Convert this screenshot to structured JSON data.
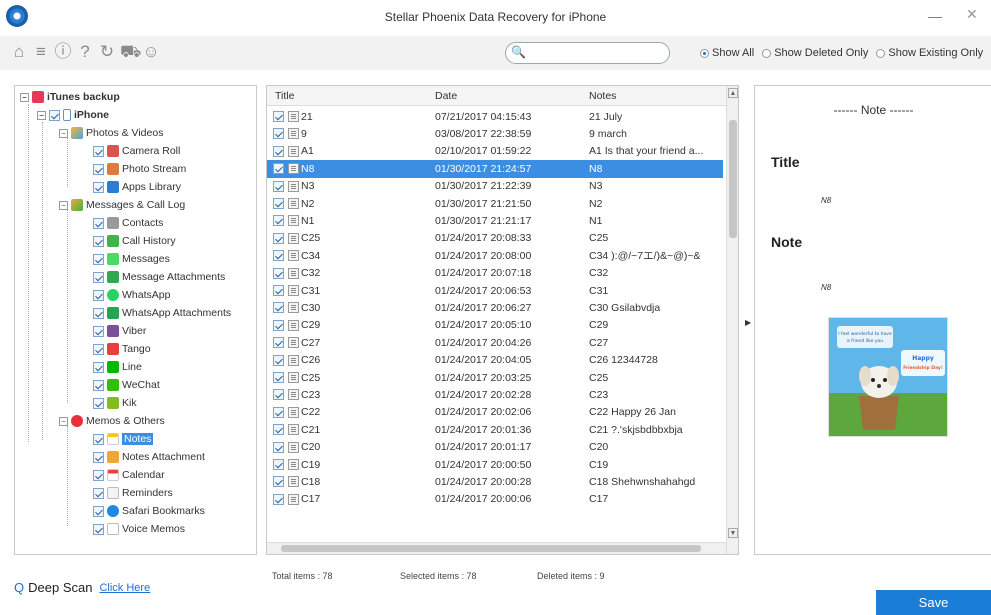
{
  "window": {
    "title": "Stellar Phoenix Data Recovery for iPhone",
    "minimize": "—",
    "close": "✕"
  },
  "toolbar": {
    "icons": [
      "home-icon",
      "menu-icon",
      "info-icon",
      "help-icon",
      "refresh-icon",
      "cart-icon",
      "account-icon"
    ],
    "search_value": "",
    "filters": [
      {
        "label": "Show All",
        "checked": true
      },
      {
        "label": "Show Deleted Only",
        "checked": false
      },
      {
        "label": "Show Existing Only",
        "checked": false
      }
    ]
  },
  "tree": {
    "root": "iTunes backup",
    "device": "iPhone",
    "groups": [
      {
        "label": "Photos & Videos",
        "items": [
          "Camera Roll",
          "Photo Stream",
          "Apps Library"
        ]
      },
      {
        "label": "Messages & Call Log",
        "items": [
          "Contacts",
          "Call History",
          "Messages",
          "Message Attachments",
          "WhatsApp",
          "WhatsApp Attachments",
          "Viber",
          "Tango",
          "Line",
          "WeChat",
          "Kik"
        ]
      },
      {
        "label": "Memos & Others",
        "items": [
          "Notes",
          "Notes Attachment",
          "Calendar",
          "Reminders",
          "Safari Bookmarks",
          "Voice Memos"
        ]
      }
    ],
    "selected": "Notes"
  },
  "table": {
    "columns": [
      "Title",
      "Date",
      "Notes"
    ],
    "rows": [
      [
        "21",
        "07/21/2017 04:15:43",
        "21 July"
      ],
      [
        "9",
        "03/08/2017 22:38:59",
        "9 march"
      ],
      [
        "A1",
        "02/10/2017 01:59:22",
        "A1 Is that your friend a..."
      ],
      [
        "N8",
        "01/30/2017 21:24:57",
        "N8"
      ],
      [
        "N3",
        "01/30/2017 21:22:39",
        "N3"
      ],
      [
        "N2",
        "01/30/2017 21:21:50",
        "N2"
      ],
      [
        "N1",
        "01/30/2017 21:21:17",
        "N1"
      ],
      [
        "C25",
        "01/24/2017 20:08:33",
        "C25"
      ],
      [
        "C34",
        "01/24/2017 20:08:00",
        "C34 ):@/~7エ/)&~@)~&"
      ],
      [
        "C32",
        "01/24/2017 20:07:18",
        "C32"
      ],
      [
        "C31",
        "01/24/2017 20:06:53",
        "C31"
      ],
      [
        "C30",
        "01/24/2017 20:06:27",
        "C30 Gsilabvdja"
      ],
      [
        "C29",
        "01/24/2017 20:05:10",
        "C29"
      ],
      [
        "C27",
        "01/24/2017 20:04:26",
        "C27"
      ],
      [
        "C26",
        "01/24/2017 20:04:05",
        "C26 12344728"
      ],
      [
        "C25",
        "01/24/2017 20:03:25",
        "C25"
      ],
      [
        "C23",
        "01/24/2017 20:02:28",
        "C23"
      ],
      [
        "C22",
        "01/24/2017 20:02:06",
        "C22 Happy 26 Jan"
      ],
      [
        "C21",
        "01/24/2017 20:01:36",
        "C21 ?.'skjsbdbbxbja"
      ],
      [
        "C20",
        "01/24/2017 20:01:17",
        "C20"
      ],
      [
        "C19",
        "01/24/2017 20:00:50",
        "C19"
      ],
      [
        "C18",
        "01/24/2017 20:00:28",
        "C18 Shehwnshahahgd"
      ],
      [
        "C17",
        "01/24/2017 20:00:06",
        "C17"
      ]
    ],
    "selected_index": 3
  },
  "status": {
    "total": "Total items : 78",
    "selected": "Selected items : 78",
    "deleted": "Deleted items : 9"
  },
  "note": {
    "header": "------ Note ------",
    "title_label": "Title",
    "title_value": "N8",
    "note_label": "Note",
    "note_value": "N8",
    "image_caption": "Happy Friendship Day!",
    "image_text": "I feel wonderful to have a friend like you"
  },
  "footer": {
    "deep_scan": "Deep Scan",
    "click_here": "Click Here",
    "save": "Save"
  },
  "colors": {
    "accent": "#1a7dd8",
    "selection": "#3c8ee3"
  }
}
